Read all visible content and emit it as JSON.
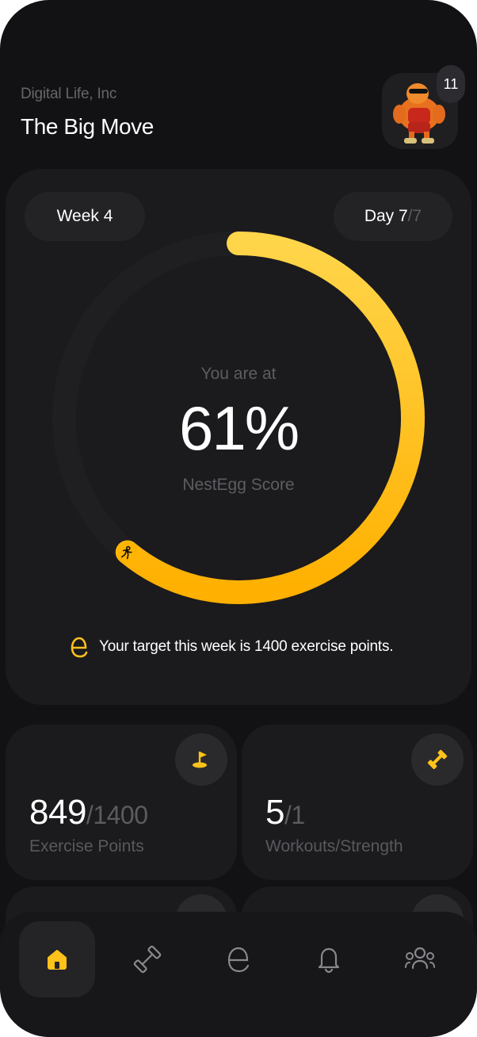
{
  "header": {
    "company": "Digital Life, Inc",
    "title": "The Big Move",
    "notification_count": "11"
  },
  "score_card": {
    "week_label": "Week 4",
    "day_label": "Day 7",
    "day_total": "/7",
    "prefix": "You are at",
    "score": "61%",
    "score_fraction": 0.61,
    "score_name": "NestEgg Score",
    "target_text": "Your target this week is 1400 exercise points."
  },
  "stats": [
    {
      "value": "849",
      "total": "/1400",
      "label": "Exercise Points",
      "icon": "golf-flag-icon"
    },
    {
      "value": "5",
      "total": "/1",
      "label": "Workouts/Strength",
      "icon": "dumbbell-icon"
    }
  ],
  "tabs": [
    {
      "name": "home",
      "icon": "home-icon",
      "active": true
    },
    {
      "name": "workouts",
      "icon": "dumbbell-icon",
      "active": false
    },
    {
      "name": "nestegg",
      "icon": "nestegg-logo-icon",
      "active": false
    },
    {
      "name": "notifications",
      "icon": "bell-icon",
      "active": false
    },
    {
      "name": "community",
      "icon": "users-icon",
      "active": false
    }
  ],
  "colors": {
    "background": "#121113",
    "card": "#1b1a1d",
    "accent_start": "#ffd54a",
    "accent_end": "#ffb000"
  }
}
